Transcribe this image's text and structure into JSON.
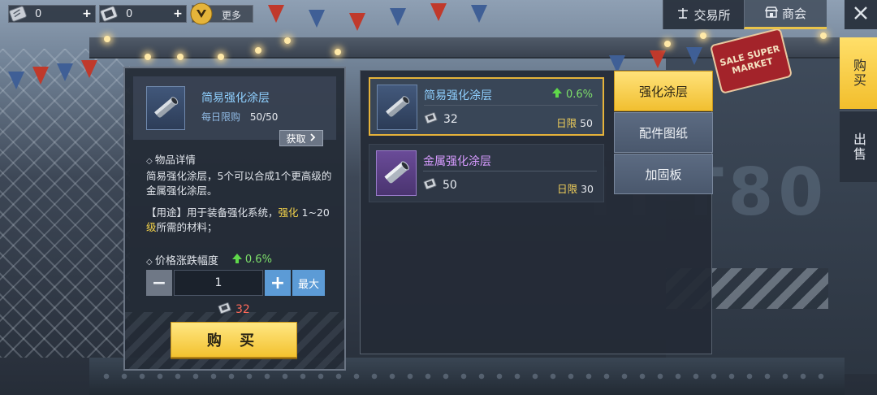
{
  "top": {
    "resources": [
      {
        "icon": "ticket-icon",
        "value": "0"
      },
      {
        "icon": "bolt-voucher-icon",
        "value": "0"
      }
    ],
    "more_label": "更多",
    "tabs": [
      {
        "label": "交易所",
        "icon": "exchange-icon"
      },
      {
        "label": "商会",
        "icon": "shop-icon"
      }
    ]
  },
  "side_tabs": {
    "buy": "购买",
    "sell": "出售"
  },
  "background": {
    "sign_text": "SALE SUPER MARKET",
    "wall_text": "IT-T80"
  },
  "detail": {
    "name": "简易强化涂层",
    "daily_limit_label": "每日限购",
    "daily_limit_value": "50/50",
    "get_label": "获取",
    "details_title": "物品详情",
    "description": "简易强化涂层，5个可以合成1个更高级的金属强化涂层。",
    "usage_prefix": "【用途】用于装备强化系统，",
    "usage_highlight1": "强化",
    "usage_range": "1~20",
    "usage_highlight2": "级",
    "usage_suffix": "所需的材料；",
    "price_change_label": "价格涨跌幅度",
    "price_change_value": "0.6%",
    "quantity": "1",
    "max_label": "最大",
    "total_cost": "32",
    "buy_label": "购 买"
  },
  "items": [
    {
      "name": "简易强化涂层",
      "change": "0.6%",
      "price": "32",
      "daily_label": "日限",
      "daily_value": "50",
      "rarity": "blue",
      "selected": true
    },
    {
      "name": "金属强化涂层",
      "change": "",
      "price": "50",
      "daily_label": "日限",
      "daily_value": "30",
      "rarity": "purple",
      "selected": false
    }
  ],
  "categories": [
    "强化涂层",
    "配件图纸",
    "加固板"
  ],
  "colors": {
    "accent_gold": "#f2be2c",
    "rarity_blue": "#8fd0ff",
    "rarity_purple": "#d79bff",
    "rise_green": "#7ee06b",
    "cost_red": "#ff6a5a"
  }
}
